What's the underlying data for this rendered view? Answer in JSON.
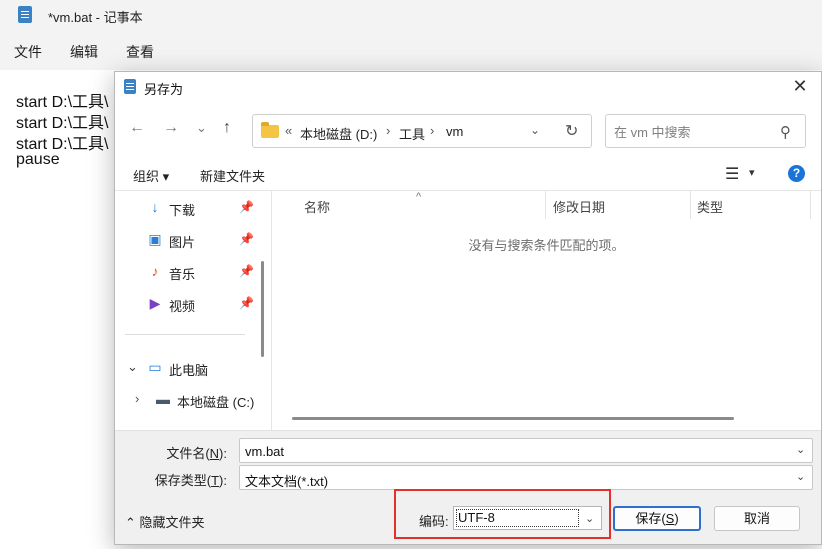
{
  "notepad": {
    "title": "*vm.bat - 记事本",
    "menu": [
      "文件",
      "编辑",
      "查看"
    ],
    "lines": [
      "start D:\\工具\\",
      "start D:\\工具\\",
      "start D:\\工具\\",
      "pause"
    ]
  },
  "dialog": {
    "title": "另存为",
    "close_glyph": "✕",
    "nav": {
      "back": "←",
      "forward": "→",
      "recent": "⌄",
      "up": "↑"
    },
    "address": {
      "prefix": "«",
      "crumbs": [
        "本地磁盘 (D:)",
        "工具",
        "vm"
      ],
      "separator": "›",
      "dropdown_glyph": "⌄",
      "refresh_glyph": "↻"
    },
    "search": {
      "placeholder": "在 vm 中搜索",
      "icon_glyph": "⚲"
    },
    "toolbar": {
      "organize": "组织 ▾",
      "new_folder": "新建文件夹",
      "view_glyph": "☰",
      "view_dropdown": "▾",
      "help": "?"
    },
    "nav_pane": {
      "quick_access": [
        {
          "label": "下载",
          "icon": "download-icon",
          "glyph": "↓",
          "color": "#1e7bd6",
          "pin": "📌"
        },
        {
          "label": "图片",
          "icon": "pictures-icon",
          "glyph": "▣",
          "color": "#2b7fd4",
          "pin": "📌"
        },
        {
          "label": "音乐",
          "icon": "music-icon",
          "glyph": "♪",
          "color": "#e0582a",
          "pin": "📌"
        },
        {
          "label": "视频",
          "icon": "video-icon",
          "glyph": "▶",
          "color": "#7a3fc4",
          "pin": "📌"
        }
      ],
      "tree": [
        {
          "label": "此电脑",
          "chevron": "⌄",
          "icon": "computer-icon",
          "glyph": "▭"
        },
        {
          "label": "本地磁盘 (C:)",
          "chevron": "›",
          "icon": "drive-icon",
          "glyph": "▬"
        }
      ]
    },
    "columns": [
      "名称",
      "修改日期",
      "类型"
    ],
    "sort_caret": "^",
    "empty_message": "没有与搜索条件匹配的项。",
    "filename": {
      "label_prefix": "文件名(",
      "label_key": "N",
      "label_suffix": "):",
      "value": "vm.bat"
    },
    "filetype": {
      "label_prefix": "保存类型(",
      "label_key": "T",
      "label_suffix": "):",
      "value": "文本文档(*.txt)"
    },
    "dropdown_glyph": "⌄",
    "hide_folders": "⌃  隐藏文件夹",
    "encoding": {
      "label": "编码:",
      "value": "UTF-8"
    },
    "save_button": {
      "prefix": "保存(",
      "key": "S",
      "suffix": ")"
    },
    "cancel_button": "取消"
  }
}
